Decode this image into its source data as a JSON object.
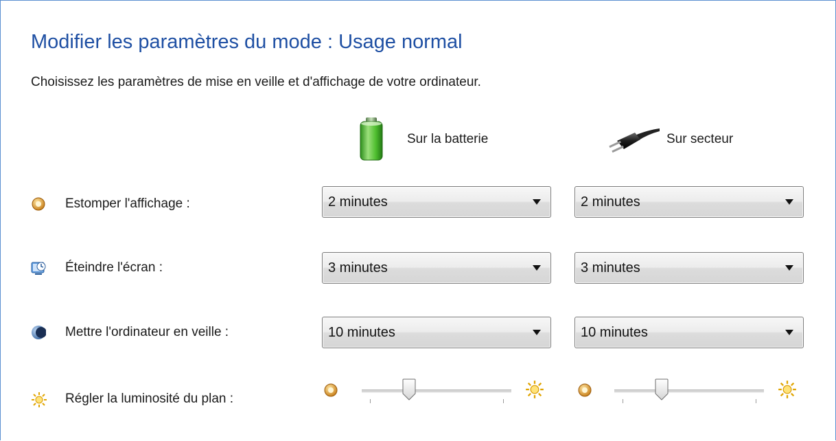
{
  "header": {
    "title": "Modifier les paramètres du mode : Usage normal",
    "subtitle": "Choisissez les paramètres de mise en veille et d'affichage de votre ordinateur."
  },
  "columns": {
    "battery": {
      "label": "Sur la batterie",
      "icon": "battery-icon"
    },
    "plugged": {
      "label": "Sur secteur",
      "icon": "power-plug-icon"
    }
  },
  "rows": [
    {
      "label": "Estomper l'affichage :",
      "icon": "dim-display-icon",
      "battery": "2 minutes",
      "plugged": "2 minutes"
    },
    {
      "label": "Éteindre l'écran :",
      "icon": "turn-off-display-icon",
      "battery": "3 minutes",
      "plugged": "3 minutes"
    },
    {
      "label": "Mettre l'ordinateur en veille :",
      "icon": "sleep-moon-icon",
      "battery": "10 minutes",
      "plugged": "10 minutes"
    }
  ],
  "brightness": {
    "label": "Régler la luminosité du plan :",
    "icon": "brightness-sun-icon",
    "battery_level": 0.3,
    "plugged_level": 0.3
  },
  "colors": {
    "title": "#1e4fa3",
    "border": "#5a8fd0"
  }
}
